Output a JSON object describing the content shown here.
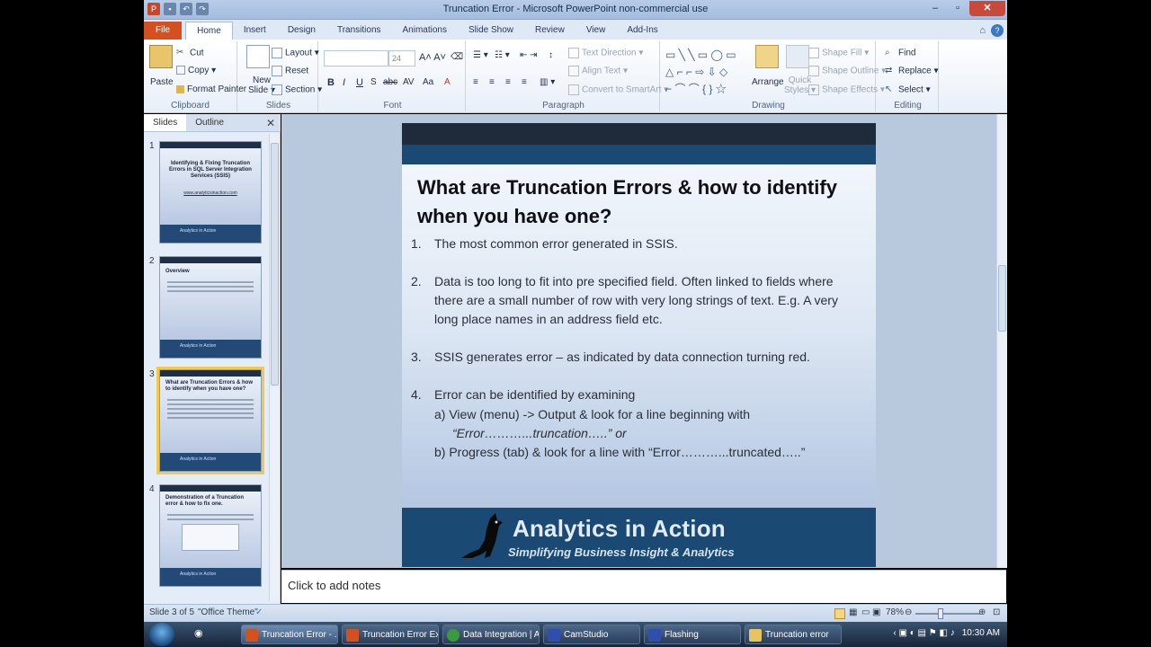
{
  "window": {
    "title": "Truncation Error - Microsoft PowerPoint non-commercial use"
  },
  "ribbon_tabs": [
    "File",
    "Home",
    "Insert",
    "Design",
    "Transitions",
    "Animations",
    "Slide Show",
    "Review",
    "View",
    "Add-Ins"
  ],
  "ribbon": {
    "clipboard": {
      "paste": "Paste",
      "cut": "Cut",
      "copy": "Copy",
      "format_painter": "Format Painter",
      "label": "Clipboard"
    },
    "slides": {
      "new_slide_1": "New",
      "new_slide_2": "Slide",
      "layout": "Layout",
      "reset": "Reset",
      "section": "Section",
      "label": "Slides"
    },
    "font": {
      "size": "24",
      "label": "Font"
    },
    "paragraph": {
      "text_direction": "Text Direction",
      "align_text": "Align Text",
      "convert": "Convert to SmartArt",
      "label": "Paragraph"
    },
    "drawing": {
      "arrange": "Arrange",
      "quick_styles_1": "Quick",
      "quick_styles_2": "Styles",
      "shape_fill": "Shape Fill",
      "shape_outline": "Shape Outline",
      "shape_effects": "Shape Effects",
      "label": "Drawing"
    },
    "editing": {
      "find": "Find",
      "replace": "Replace",
      "select": "Select",
      "label": "Editing"
    }
  },
  "panel": {
    "tab_slides": "Slides",
    "tab_outline": "Outline",
    "thumbs": [
      {
        "num": "1",
        "title": "Identifying & Fixing Truncation Errors in SQL Server Integration Services (SSIS)",
        "link": "www.analyticsinaction.com"
      },
      {
        "num": "2",
        "title": "Overview"
      },
      {
        "num": "3",
        "title": "What are Truncation Errors & how to identify when you have one?"
      },
      {
        "num": "4",
        "title": "Demonstration of a Truncation error & how to fix one."
      }
    ],
    "thumb_brand": "Analytics in Action"
  },
  "slide": {
    "title": "What are Truncation Errors & how to identify when you have one?",
    "points": [
      {
        "n": "1.",
        "text": "The most common error generated in SSIS."
      },
      {
        "n": "2.",
        "text": "Data is too long to fit into pre specified field. Often linked to fields where there are a small number of row with  very long strings of text. E.g. A very long place names in an address field etc."
      },
      {
        "n": "3.",
        "text": "SSIS generates error – as indicated by data connection turning red."
      },
      {
        "n": "4.",
        "text": "Error can be identified by examining"
      }
    ],
    "sub_a_1": "a)  View (menu)   ->   Output &  look for a line beginning with",
    "sub_a_2": "“Error………...truncation…..” or",
    "sub_b": "b)  Progress (tab) & look for a line with  “Error………...truncated…..”",
    "brand": "Analytics in Action",
    "tagline": "Simplifying Business Insight & Analytics"
  },
  "notes_placeholder": "Click to add notes",
  "status": {
    "slide": "Slide 3 of 5",
    "theme": "\"Office Theme\"",
    "zoom": "78%"
  },
  "taskbar": {
    "items": [
      "Truncation Error - ...",
      "Truncation Error Exa...",
      "Data Integration | A...",
      "CamStudio",
      "Flashing",
      "Truncation error"
    ],
    "clock": "10:30 AM"
  },
  "colors": {
    "file_tab": "#d5501f",
    "slide_band": "#1a4a74",
    "selected_thumb": "#f4c84a"
  }
}
